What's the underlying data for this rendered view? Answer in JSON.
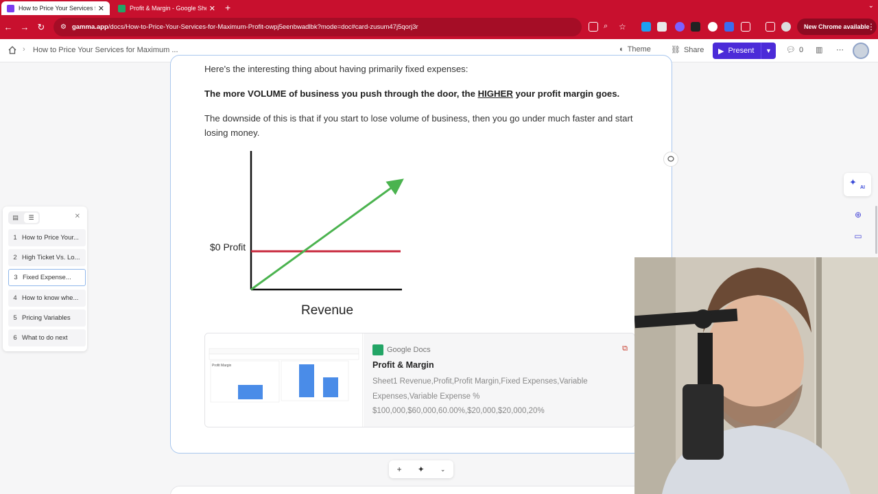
{
  "browser": {
    "tabs": [
      {
        "title": "How to Price Your Services for Maximum Profit",
        "active": true
      },
      {
        "title": "Profit & Margin - Google Sheets",
        "active": false
      }
    ],
    "url_host": "gamma.app",
    "url_path": "/docs/How-to-Price-Your-Services-for-Maximum-Profit-owpj5eenbwadlbk?mode=doc#card-zusum47j5qorj3r",
    "new_chrome": "New Chrome available",
    "accent": "#c8102e"
  },
  "header": {
    "breadcrumb": "How to Price Your Services for Maximum ...",
    "theme": "Theme",
    "share": "Share",
    "present": "Present",
    "comments": "0",
    "brand_color": "#4b2bd8"
  },
  "content": {
    "p1": "Here's the interesting thing about having primarily fixed expenses:",
    "p2_a": "The more VOLUME of business you push through the door, the ",
    "p2_u": "HIGHER",
    "p2_b": " your profit margin goes.",
    "p3": "The downside of this is that if you start to lose volume of business, then you go under much faster and start losing money."
  },
  "chart_data": {
    "type": "line",
    "xlabel": "Revenue",
    "ylabel": "",
    "annotations": [
      "$0 Profit"
    ],
    "series": [
      {
        "role": "profit-line",
        "color": "#4bb34f",
        "points": [
          [
            0,
            0
          ],
          [
            1,
            0.85
          ]
        ],
        "arrow": true
      },
      {
        "role": "zero-profit",
        "color": "#c8283c",
        "points": [
          [
            0,
            0.3
          ],
          [
            1,
            0.3
          ]
        ]
      }
    ],
    "xlim": [
      0,
      1
    ],
    "ylim": [
      0,
      1
    ]
  },
  "embed": {
    "source": "Google Docs",
    "title": "Profit & Margin",
    "desc_1": "Sheet1 Revenue,Profit,Profit Margin,Fixed Expenses,Variable",
    "desc_2": "Expenses,Variable Expense %",
    "desc_3": "$100,000,$60,000,60.00%,$20,000,$20,000,20%",
    "thumb_chart_1_title": "Profit Margin"
  },
  "outline": {
    "items": [
      {
        "num": "1",
        "label": "How to Price Your..."
      },
      {
        "num": "2",
        "label": "High Ticket Vs. Lo..."
      },
      {
        "num": "3",
        "label": "Fixed Expense...",
        "selected": true
      },
      {
        "num": "4",
        "label": "How to know whe..."
      },
      {
        "num": "5",
        "label": "Pricing Variables"
      },
      {
        "num": "6",
        "label": "What to do next"
      }
    ]
  },
  "rail": {
    "ai_label": "AI"
  }
}
